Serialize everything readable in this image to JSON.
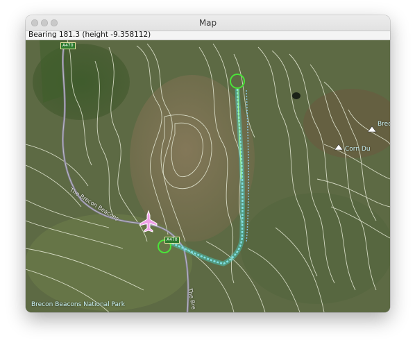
{
  "window": {
    "title": "Map"
  },
  "status": {
    "bearing_text": "Bearing 181.3 (height -9.358112)"
  },
  "map": {
    "park_label": "Brecon Beacons National Park",
    "peak_label_1": "Corn Du",
    "peak_label_2": "Brecon",
    "road_shield_a470": "A470",
    "road_shield_a470_north": "A470",
    "road_label_brecon_beacons": "The Brecon Beacons",
    "road_label_brecon_south": "The Bre",
    "colors": {
      "terrain": "#5f6a45",
      "contour": "#e8ecd8",
      "track": "#7fe0e6",
      "waypoint_ring": "#4be33a",
      "aircraft": "#f0a0e8"
    }
  }
}
